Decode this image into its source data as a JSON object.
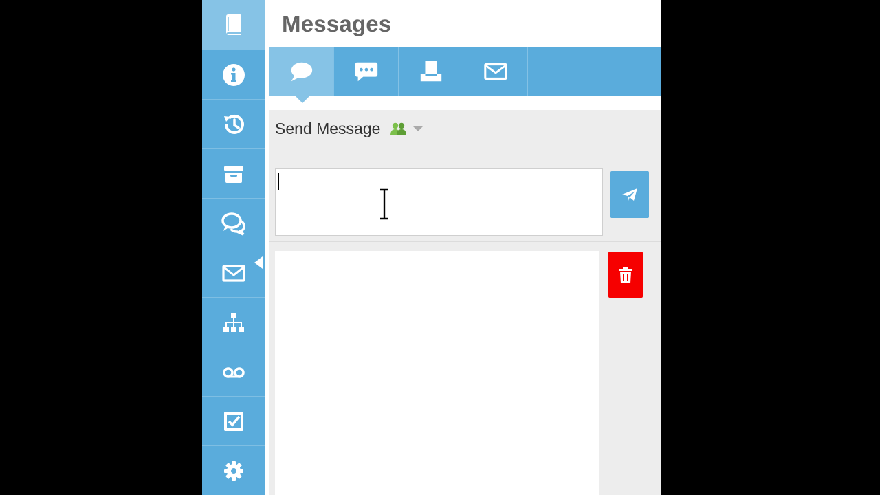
{
  "header": {
    "title": "Messages"
  },
  "sidebar": {
    "items": [
      {
        "icon": "book-icon",
        "active": true
      },
      {
        "icon": "info-icon"
      },
      {
        "icon": "history-icon"
      },
      {
        "icon": "archive-icon"
      },
      {
        "icon": "chat-bubbles-icon"
      },
      {
        "icon": "envelope-icon",
        "selected_pointer": true
      },
      {
        "icon": "org-chart-icon"
      },
      {
        "icon": "voicemail-icon"
      },
      {
        "icon": "checkbox-icon"
      },
      {
        "icon": "gear-icon"
      }
    ]
  },
  "tabs": [
    {
      "icon": "chat-bubble-icon",
      "active": true
    },
    {
      "icon": "sms-icon"
    },
    {
      "icon": "fax-icon"
    },
    {
      "icon": "envelope-icon"
    }
  ],
  "compose": {
    "send_label": "Send Message",
    "recipient_icon": "group-icon",
    "input_value": "",
    "send_button_icon": "paper-plane-icon"
  },
  "messages": {
    "items": [],
    "delete_button_icon": "trash-icon"
  },
  "colors": {
    "primary": "#5aacdc",
    "active": "#86c3e6",
    "danger": "#f60000",
    "group_icon": "#7cc04b"
  }
}
